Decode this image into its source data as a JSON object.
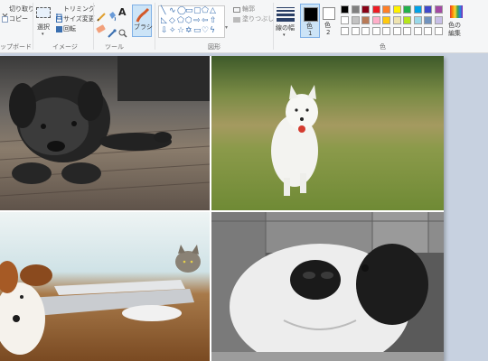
{
  "ribbon": {
    "clipboard": {
      "cut": "切り取り",
      "copy": "コピー",
      "label": "ップボード"
    },
    "image": {
      "select": "選択",
      "crop": "トリミング",
      "resize": "サイズ変更",
      "rotate": "回転",
      "label": "イメージ"
    },
    "tools": {
      "label": "ツール",
      "text_icon": "A"
    },
    "brush": {
      "label": "ブラシ"
    },
    "shapes": {
      "outline": "輪郭",
      "fill": "塗りつぶし",
      "label": "図形"
    },
    "size": {
      "label": "線の幅"
    },
    "color1": {
      "label": "色",
      "num": "1"
    },
    "color2": {
      "label": "色",
      "num": "2"
    },
    "colors": {
      "label": "色",
      "row1": [
        "#000000",
        "#7f7f7f",
        "#880015",
        "#ed1c24",
        "#ff7f27",
        "#fff200",
        "#22b14c",
        "#00a2e8",
        "#3f48cc",
        "#a349a4"
      ],
      "row2": [
        "#ffffff",
        "#c3c3c3",
        "#b97a57",
        "#ffaec9",
        "#ffc90e",
        "#efe4b0",
        "#b5e61d",
        "#99d9ea",
        "#7092be",
        "#c8bfe7"
      ],
      "row3": [
        "#ffffff",
        "#ffffff",
        "#ffffff",
        "#ffffff",
        "#ffffff",
        "#ffffff",
        "#ffffff",
        "#ffffff",
        "#ffffff",
        "#ffffff"
      ]
    },
    "edit_colors": {
      "line1": "色の",
      "line2": "編集"
    }
  }
}
